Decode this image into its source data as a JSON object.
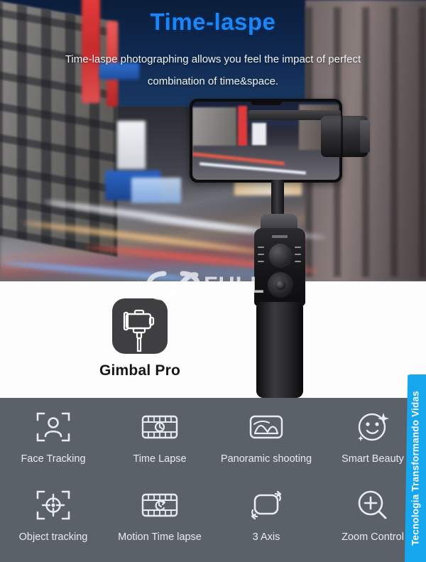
{
  "hero": {
    "title": "Time-laspe",
    "subtitle_line1": "Time-laspe photographing allows you feel the impact of perfect",
    "subtitle_line2": "combination of time&space.",
    "title_color": "#1a86f7",
    "subtitle_color": "#f2f4f6"
  },
  "watermark": {
    "text": "FULL",
    "symbol": "infinity-loop"
  },
  "brand": {
    "name": "Gimbal Pro",
    "icon": "gimbal-stabilizer-icon",
    "icon_bg": "#3f3f41",
    "name_color": "#17171a"
  },
  "features": {
    "panel_color": "#5b6169",
    "label_color": "#e9ecef",
    "rows": [
      [
        {
          "label": "Face Tracking",
          "icon": "face-tracking-icon"
        },
        {
          "label": "Time Lapse",
          "icon": "time-lapse-filmstrip-icon"
        },
        {
          "label": "Panoramic shooting",
          "icon": "panorama-image-icon"
        },
        {
          "label": "Smart Beauty",
          "icon": "smiley-sparkle-icon"
        }
      ],
      [
        {
          "label": "Object tracking",
          "icon": "crosshair-target-icon"
        },
        {
          "label": "Motion Time lapse",
          "icon": "motion-timelapse-filmstrip-icon"
        },
        {
          "label": "3 Axis",
          "icon": "three-axis-rotation-icon"
        },
        {
          "label": "Zoom Control",
          "icon": "magnifier-plus-icon"
        }
      ]
    ]
  },
  "side_banner": {
    "text": "Tecnologia Transformando Vidas",
    "color": "#17a7ef",
    "text_color": "#ffffff"
  }
}
